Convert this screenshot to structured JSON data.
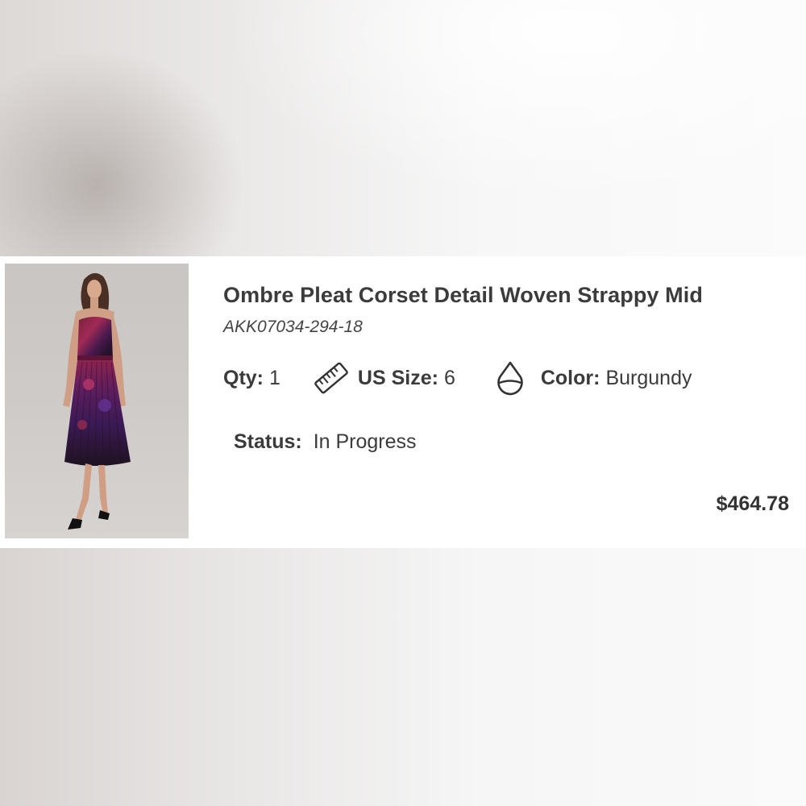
{
  "product": {
    "title": "Ombre Pleat Corset Detail Woven Strappy Mid",
    "sku": "AKK07034-294-18",
    "price": "$464.78",
    "image_icon": "product-photo"
  },
  "attributes": {
    "qty_label": "Qty:",
    "qty_value": "1",
    "size_label": "US Size:",
    "size_value": "6",
    "size_icon": "ruler-icon",
    "color_label": "Color:",
    "color_value": "Burgundy",
    "color_icon": "droplet-icon"
  },
  "status": {
    "label": "Status:",
    "value": "In Progress"
  }
}
